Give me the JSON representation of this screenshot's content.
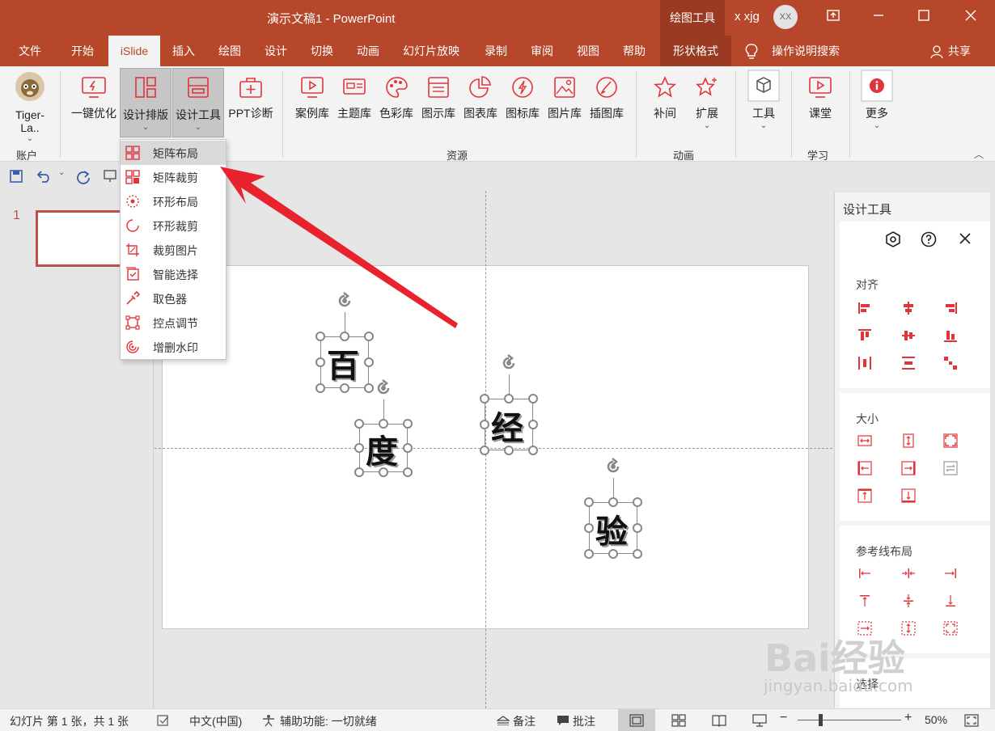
{
  "window": {
    "title": "演示文稿1  -  PowerPoint",
    "contextual_tab": "绘图工具",
    "user": "x xjg",
    "avatar_initials": "XX"
  },
  "tabs": [
    "文件",
    "开始",
    "iSlide",
    "插入",
    "绘图",
    "设计",
    "切换",
    "动画",
    "幻灯片放映",
    "录制",
    "审阅",
    "视图",
    "帮助",
    "形状格式"
  ],
  "active_tab": "iSlide",
  "search": "操作说明搜索",
  "share": "共享",
  "ribbon": {
    "account": {
      "label": "Tiger-La..",
      "group": "账户"
    },
    "optimize": {
      "one_click": "一键优化",
      "layout": "设计排版",
      "tools": "设计工具",
      "diagnose": "PPT诊断"
    },
    "resources": {
      "items": [
        "案例库",
        "主题库",
        "色彩库",
        "图示库",
        "图表库",
        "图标库",
        "图片库",
        "插图库"
      ],
      "group": "资源"
    },
    "animation": {
      "items": [
        "补间",
        "扩展"
      ],
      "group": "动画"
    },
    "tools": {
      "label": "工具"
    },
    "learn": {
      "label": "课堂",
      "group": "学习"
    },
    "more": {
      "label": "更多"
    }
  },
  "dropdown_menu": {
    "items": [
      "矩阵布局",
      "矩阵裁剪",
      "环形布局",
      "环形裁剪",
      "裁剪图片",
      "智能选择",
      "取色器",
      "控点调节",
      "增删水印"
    ],
    "highlighted": "矩阵布局"
  },
  "slide_panel": {
    "slide_number": "1"
  },
  "slide": {
    "chars": [
      "百",
      "度",
      "经",
      "验"
    ]
  },
  "design_panel": {
    "title": "设计工具",
    "sections": {
      "align": "对齐",
      "size": "大小",
      "guide": "参考线布局",
      "select": "选择"
    }
  },
  "statusbar": {
    "slide_info": "幻灯片 第 1 张，共 1 张",
    "language": "中文(中国)",
    "accessibility": "辅助功能: 一切就绪",
    "notes": "备注",
    "comments": "批注",
    "zoom": "50%"
  },
  "watermark": {
    "logo": "Bai经验",
    "url": "jingyan.baidu.com"
  },
  "colors": {
    "accent": "#b7472a",
    "icon_red": "#e0363b",
    "arrow": "#e8232e"
  }
}
